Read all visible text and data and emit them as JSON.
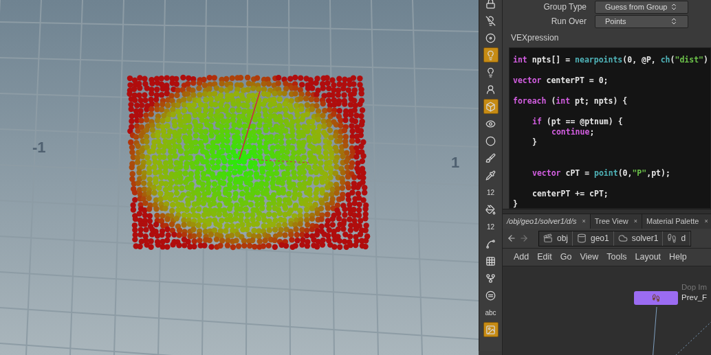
{
  "viewport": {
    "axis_labels": [
      {
        "text": "-1",
        "kind": "left"
      },
      {
        "text": "1",
        "kind": "right"
      }
    ]
  },
  "toolbar": [
    {
      "kind": "icon",
      "selected": false
    },
    {
      "kind": "icon",
      "selected": false
    },
    {
      "kind": "icon",
      "selected": false
    },
    {
      "kind": "icon",
      "selected": true
    },
    {
      "kind": "icon",
      "selected": false
    },
    {
      "kind": "icon",
      "selected": false
    },
    {
      "kind": "icon",
      "selected": true
    },
    {
      "kind": "icon",
      "selected": false
    },
    {
      "kind": "icon",
      "selected": false
    },
    {
      "kind": "icon",
      "selected": false
    },
    {
      "kind": "icon",
      "selected": false
    },
    {
      "kind": "label",
      "text": "12",
      "selected": false
    },
    {
      "kind": "icon",
      "selected": false
    },
    {
      "kind": "label",
      "text": "12",
      "selected": false
    },
    {
      "kind": "icon",
      "selected": false
    },
    {
      "kind": "icon",
      "selected": false
    },
    {
      "kind": "icon",
      "selected": false
    },
    {
      "kind": "icon",
      "selected": false
    },
    {
      "kind": "text",
      "text": "abc",
      "selected": false
    },
    {
      "kind": "icon",
      "selected": true
    }
  ],
  "parameters": [
    {
      "label": "Group Type",
      "value": "Guess from Group"
    },
    {
      "label": "Run Over",
      "value": "Points"
    }
  ],
  "vexpression": {
    "label": "VEXpression",
    "lines": [
      {
        "kind": "code",
        "tokens": [
          {
            "kind": "keyword",
            "text": "int"
          },
          {
            "kind": "plain",
            "text": " npts[] = "
          },
          {
            "kind": "function",
            "text": "nearpoints"
          },
          {
            "kind": "plain",
            "text": "(0, @P, "
          },
          {
            "kind": "function",
            "text": "ch"
          },
          {
            "kind": "plain",
            "text": "("
          },
          {
            "kind": "string",
            "text": "\"dist\""
          },
          {
            "kind": "plain",
            "text": ")"
          }
        ]
      },
      {
        "kind": "blank"
      },
      {
        "kind": "code",
        "tokens": [
          {
            "kind": "keyword",
            "text": "vector"
          },
          {
            "kind": "plain",
            "text": " centerPT = 0;"
          }
        ]
      },
      {
        "kind": "blank"
      },
      {
        "kind": "code",
        "tokens": [
          {
            "kind": "keyword",
            "text": "foreach"
          },
          {
            "kind": "plain",
            "text": " ("
          },
          {
            "kind": "keyword",
            "text": "int"
          },
          {
            "kind": "plain",
            "text": " pt; npts) {"
          }
        ],
        "children": [
          {
            "kind": "blank"
          },
          {
            "kind": "code",
            "tokens": [
              {
                "kind": "keyword",
                "text": "if"
              },
              {
                "kind": "plain",
                "text": " (pt == @ptnum) {"
              }
            ],
            "children": [
              {
                "kind": "code",
                "tokens": [
                  {
                    "kind": "keyword",
                    "text": "continue"
                  },
                  {
                    "kind": "plain",
                    "text": ";"
                  }
                ]
              }
            ]
          },
          {
            "kind": "code",
            "tokens": [
              {
                "kind": "plain",
                "text": "}"
              }
            ]
          },
          {
            "kind": "blank"
          },
          {
            "kind": "blank"
          },
          {
            "kind": "code",
            "tokens": [
              {
                "kind": "keyword",
                "text": "vector"
              },
              {
                "kind": "plain",
                "text": " cPT = "
              },
              {
                "kind": "function",
                "text": "point"
              },
              {
                "kind": "plain",
                "text": "(0,"
              },
              {
                "kind": "string",
                "text": "\"P\""
              },
              {
                "kind": "plain",
                "text": ",pt);"
              }
            ]
          },
          {
            "kind": "blank"
          },
          {
            "kind": "code",
            "tokens": [
              {
                "kind": "plain",
                "text": "centerPT += cPT;"
              }
            ]
          }
        ]
      },
      {
        "kind": "code",
        "tokens": [
          {
            "kind": "plain",
            "text": "}"
          }
        ]
      }
    ]
  },
  "pane_tabs": [
    {
      "label": "/obj/geo1/solver1/d/s",
      "selected": true,
      "close": "×"
    },
    {
      "label": "Tree View",
      "selected": false,
      "close": "×"
    },
    {
      "label": "Material Palette",
      "selected": false,
      "close": "×"
    }
  ],
  "breadcrumbs": [
    "obj",
    "geo1",
    "solver1",
    "d"
  ],
  "menu": [
    "Add",
    "Edit",
    "Go",
    "View",
    "Tools",
    "Layout",
    "Help"
  ],
  "node": {
    "type_label": "Dop Im",
    "name": "Prev_F"
  }
}
